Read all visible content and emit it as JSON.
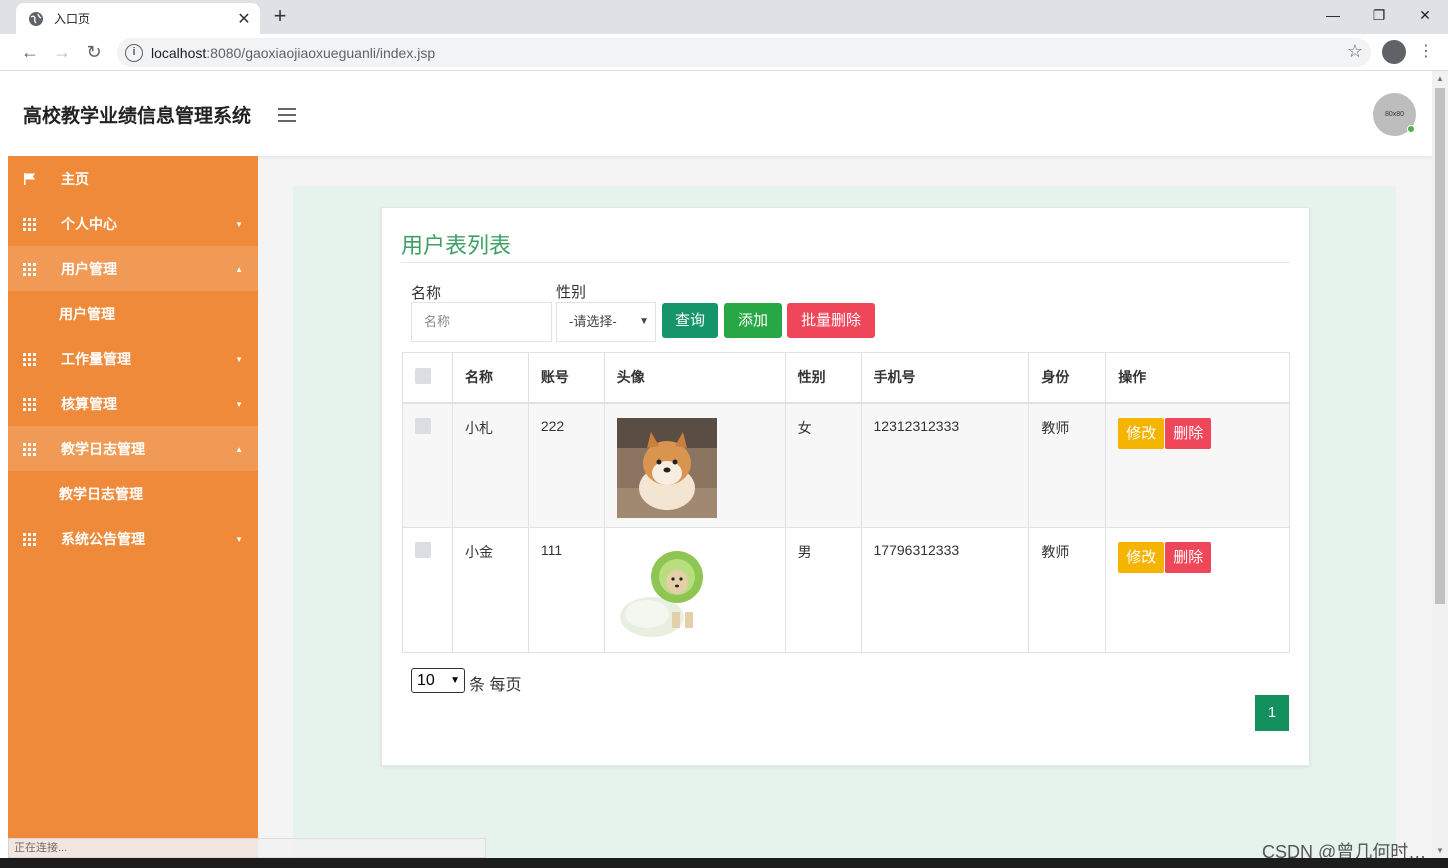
{
  "browser": {
    "tab_title": "入口页",
    "tab_close": "✕",
    "new_tab": "+",
    "url_host": "localhost",
    "url_rest": ":8080/gaoxiaojiaoxueguanli/index.jsp",
    "win_minimize": "—",
    "win_restore": "❐",
    "win_close": "✕"
  },
  "header": {
    "site_title": "高校教学业绩信息管理系统",
    "avatar_text": "80x80"
  },
  "sidebar": {
    "items": [
      {
        "label": "主页",
        "icon": "flag-icon",
        "caret": ""
      },
      {
        "label": "个人中心",
        "icon": "grid-icon",
        "caret": "▼"
      },
      {
        "label": "用户管理",
        "icon": "grid-icon",
        "caret": "▲",
        "open": true
      },
      {
        "label": "用户管理",
        "sub": true
      },
      {
        "label": "工作量管理",
        "icon": "grid-icon",
        "caret": "▼"
      },
      {
        "label": "核算管理",
        "icon": "grid-icon",
        "caret": "▼"
      },
      {
        "label": "教学日志管理",
        "icon": "grid-icon",
        "caret": "▲",
        "open": true
      },
      {
        "label": "教学日志管理",
        "sub": true
      },
      {
        "label": "系统公告管理",
        "icon": "grid-icon",
        "caret": "▼"
      }
    ]
  },
  "main": {
    "card_title": "用户表列表",
    "search": {
      "name_label": "名称",
      "name_placeholder": "名称",
      "gender_label": "性别",
      "gender_selected": "-请选择-"
    },
    "buttons": {
      "query": "查询",
      "add": "添加",
      "batch_delete": "批量删除"
    },
    "table": {
      "headers": [
        "名称",
        "账号",
        "头像",
        "性别",
        "手机号",
        "身份",
        "操作"
      ],
      "rows": [
        {
          "name": "小札",
          "account": "222",
          "avatar": "shiba-dog-photo",
          "gender": "女",
          "phone": "12312312333",
          "role": "教师",
          "edit": "修改",
          "delete": "删除"
        },
        {
          "name": "小金",
          "account": "111",
          "avatar": "cabbage-dog-photo",
          "gender": "男",
          "phone": "17796312333",
          "role": "教师",
          "edit": "修改",
          "delete": "删除"
        }
      ]
    },
    "pagination": {
      "page_size": "10",
      "per_page_text": "条 每页",
      "current_page": "1"
    }
  },
  "status": {
    "connecting": "正在连接...",
    "watermark": "CSDN @曾几何时…"
  },
  "colors": {
    "sidebar": "#ee8a3a",
    "accent_green": "#3fa064",
    "query_btn": "#16956a",
    "add_btn": "#28a745",
    "batch_delete_btn": "#f0465a",
    "edit_btn": "#f5b400",
    "delete_btn": "#f0465a"
  }
}
